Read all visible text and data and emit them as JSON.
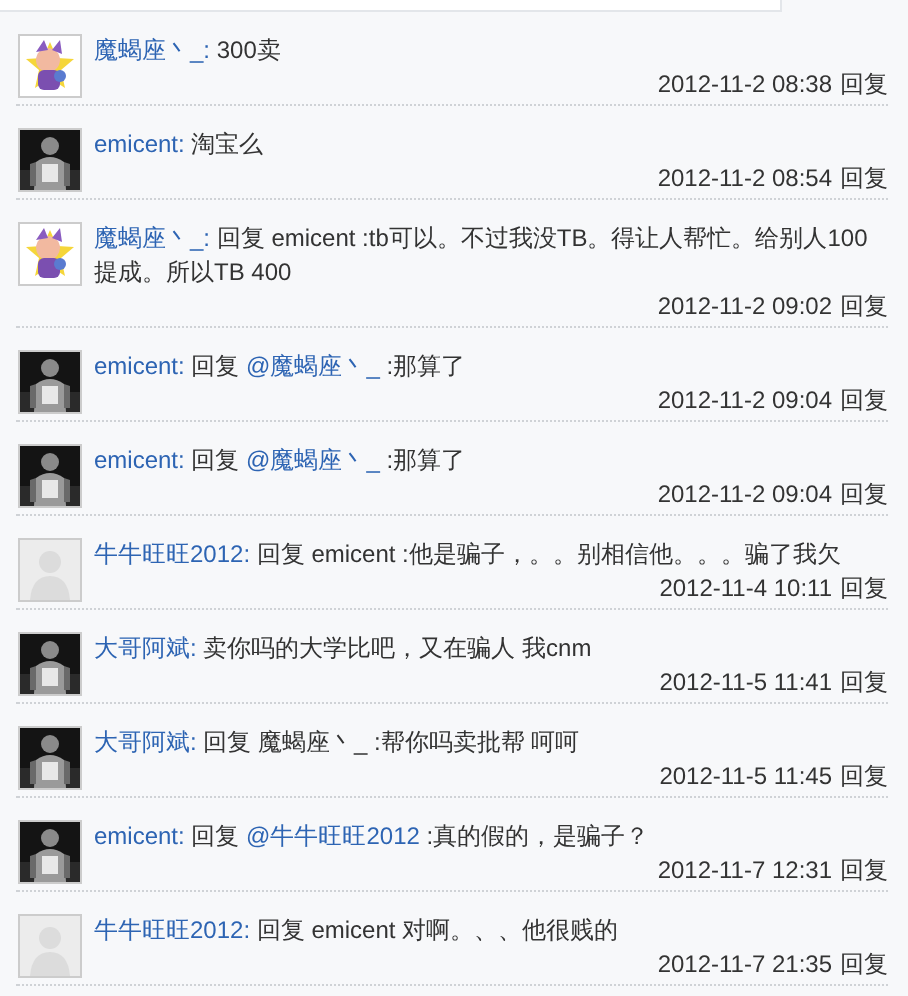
{
  "comments": [
    {
      "avatar": {
        "kind": "cartoon"
      },
      "user": "魔蝎座丶_:",
      "body": [
        {
          "kind": "plain",
          "text": "300卖"
        }
      ],
      "time": "2012-11-2 08:38",
      "reply": "回复"
    },
    {
      "user": "emicent:",
      "body": [
        {
          "kind": "plain",
          "text": "淘宝么"
        }
      ],
      "time": "2012-11-2 08:54",
      "reply": "回复"
    },
    {
      "avatar": {
        "kind": "cartoon"
      },
      "user": "魔蝎座丶_:",
      "body": [
        {
          "kind": "plain",
          "text": "回复 emicent :tb可以。不过我没TB。得让人帮忙。给别人100提成。所以TB 400"
        }
      ],
      "time": "2012-11-2 09:02",
      "reply": "回复"
    },
    {
      "user": "emicent:",
      "body": [
        {
          "kind": "plain",
          "text": "回复 "
        },
        {
          "kind": "mention",
          "text": "@魔蝎座丶_"
        },
        {
          "kind": "plain",
          "text": " :那算了"
        }
      ],
      "time": "2012-11-2 09:04",
      "reply": "回复"
    },
    {
      "user": "emicent:",
      "body": [
        {
          "kind": "plain",
          "text": "回复 "
        },
        {
          "kind": "mention",
          "text": "@魔蝎座丶_"
        },
        {
          "kind": "plain",
          "text": " :那算了"
        }
      ],
      "time": "2012-11-2 09:04",
      "reply": "回复"
    },
    {
      "avatar": {
        "kind": "placeholder"
      },
      "user": "牛牛旺旺2012:",
      "body": [
        {
          "kind": "plain",
          "text": "回复 emicent :他是骗子，。。别相信他。。。骗了我欠"
        }
      ],
      "time": "2012-11-4 10:11",
      "reply": "回复"
    },
    {
      "user": "大哥阿斌:",
      "body": [
        {
          "kind": "plain",
          "text": "卖你吗的大学比吧，又在骗人 我cnm"
        }
      ],
      "time": "2012-11-5 11:41",
      "reply": "回复"
    },
    {
      "user": "大哥阿斌:",
      "body": [
        {
          "kind": "plain",
          "text": "回复 魔蝎座丶_ :帮你吗卖批帮 呵呵"
        }
      ],
      "time": "2012-11-5 11:45",
      "reply": "回复"
    },
    {
      "user": "emicent:",
      "body": [
        {
          "kind": "plain",
          "text": "回复 "
        },
        {
          "kind": "mention",
          "text": "@牛牛旺旺2012"
        },
        {
          "kind": "plain",
          "text": " :真的假的，是骗子？"
        }
      ],
      "time": "2012-11-7 12:31",
      "reply": "回复"
    },
    {
      "avatar": {
        "kind": "placeholder"
      },
      "user": "牛牛旺旺2012:",
      "body": [
        {
          "kind": "plain",
          "text": "回复 emicent 对啊。、、他很贱的"
        }
      ],
      "time": "2012-11-7 21:35",
      "reply": "回复"
    }
  ]
}
